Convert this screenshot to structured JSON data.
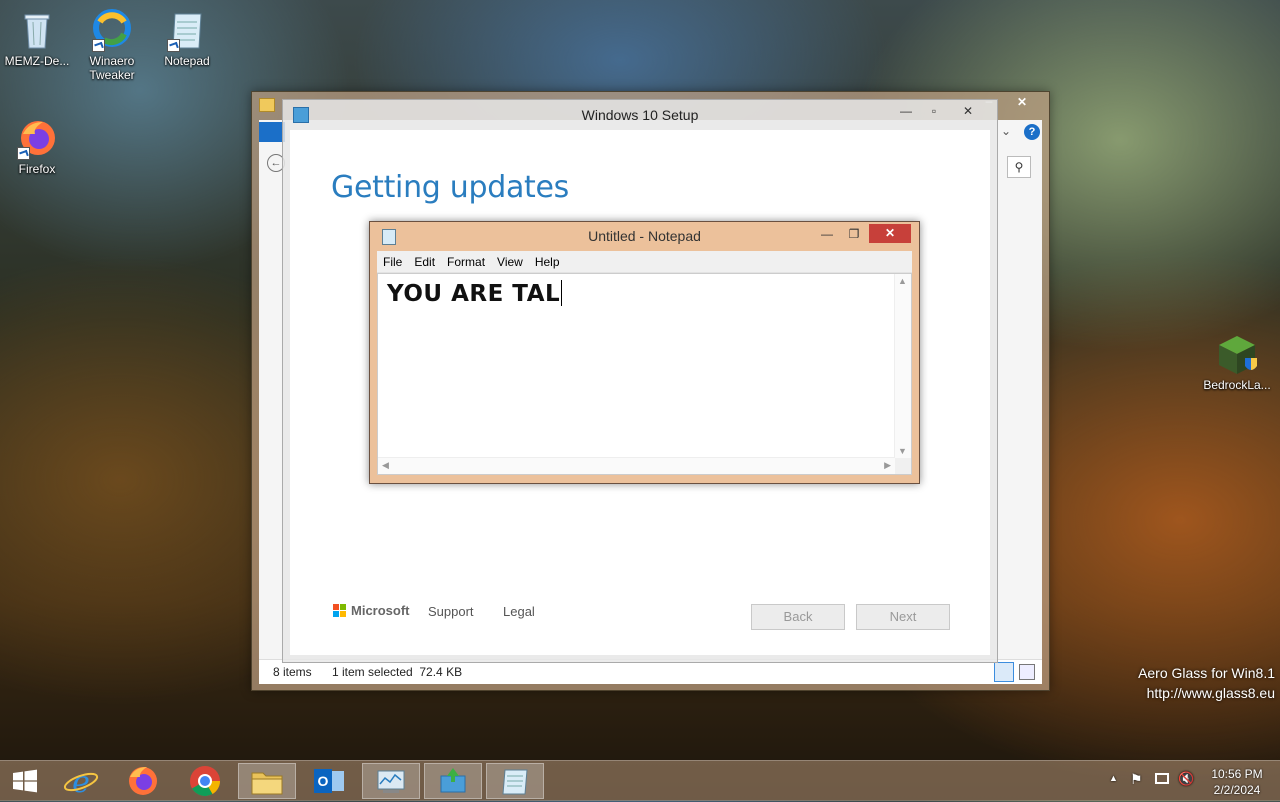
{
  "desktop": {
    "icons": [
      {
        "label": "MEMZ-De..."
      },
      {
        "label": "Winaero Tweaker"
      },
      {
        "label": "Notepad"
      },
      {
        "label": "Firefox"
      },
      {
        "label": "BedrockLa..."
      }
    ],
    "watermark": {
      "line1": "Aero Glass for Win8.1",
      "line2": "http://www.glass8.eu"
    }
  },
  "explorer": {
    "status_items": "8 items",
    "status_selected": "1 item selected  72.4 KB"
  },
  "setup": {
    "title": "Windows 10 Setup",
    "heading": "Getting updates",
    "footer": {
      "brand": "Microsoft",
      "support": "Support",
      "legal": "Legal"
    },
    "buttons": {
      "back": "Back",
      "next": "Next"
    }
  },
  "notepad": {
    "title": "Untitled - Notepad",
    "menu": [
      "File",
      "Edit",
      "Format",
      "View",
      "Help"
    ],
    "content": "YOU ARE TAL"
  },
  "taskbar": {
    "time": "10:56 PM",
    "date": "2/2/2024"
  }
}
